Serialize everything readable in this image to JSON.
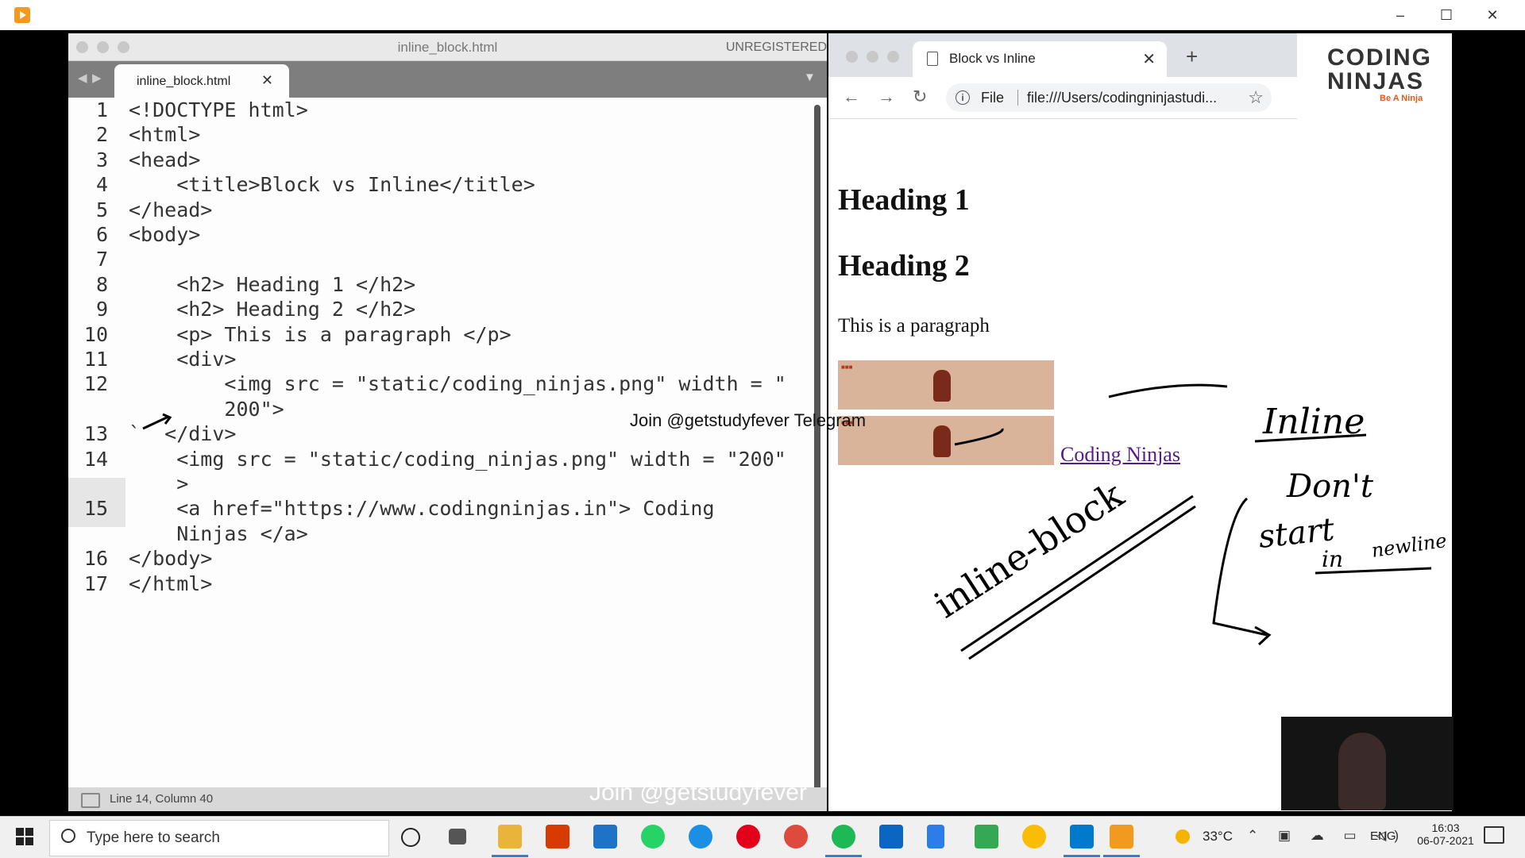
{
  "editor": {
    "title": "inline_block.html",
    "unregistered": "UNREGISTERED",
    "tab_label": "inline_block.html",
    "status": "Line 14, Column 40",
    "lines": [
      {
        "n": "1",
        "text": "<!DOCTYPE html>"
      },
      {
        "n": "2",
        "text": "<html>"
      },
      {
        "n": "3",
        "text": "<head>"
      },
      {
        "n": "4",
        "text": "    <title>Block vs Inline</title>"
      },
      {
        "n": "5",
        "text": "</head>"
      },
      {
        "n": "6",
        "text": "<body>"
      },
      {
        "n": "7",
        "text": ""
      },
      {
        "n": "8",
        "text": "    <h2> Heading 1 </h2>"
      },
      {
        "n": "9",
        "text": "    <h2> Heading 2 </h2>"
      },
      {
        "n": "10",
        "text": "    <p> This is a paragraph </p>"
      },
      {
        "n": "11",
        "text": "    <div>"
      },
      {
        "n": "12",
        "text": "        <img src = \"static/coding_ninjas.png\" width = \""
      },
      {
        "n": "",
        "text": "        200\">"
      },
      {
        "n": "13",
        "text": "`  </div>"
      },
      {
        "n": "14",
        "text": "    <img src = \"static/coding_ninjas.png\" width = \"200\""
      },
      {
        "n": "",
        "text": "    >"
      },
      {
        "n": "15",
        "text": "    <a href=\"https://www.codingninjas.in\"> Coding"
      },
      {
        "n": "",
        "text": "    Ninjas </a>"
      },
      {
        "n": "16",
        "text": "</body>"
      },
      {
        "n": "17",
        "text": "</html>"
      }
    ]
  },
  "browser": {
    "tab_title": "Block vs Inline",
    "new_tab": "+",
    "file_label": "File",
    "url": "file:///Users/codingninjastudi...",
    "logo_line1": "CODING",
    "logo_line2": "NINJAS",
    "logo_tag": "Be A Ninja",
    "heading1": "Heading 1",
    "heading2": "Heading 2",
    "paragraph": "This is a paragraph",
    "link": "Coding Ninjas"
  },
  "watermark": {
    "telegram": "Join @getstudyfever Telegram",
    "bottom": "Join @getstudyfever"
  },
  "annotations": {
    "inline_block": "inline-block",
    "inline": "Inline",
    "dont": "Don't",
    "start": "start",
    "in": "in",
    "newline": "newline"
  },
  "taskbar": {
    "search_placeholder": "Type here to search",
    "temperature": "33°C",
    "language": "ENG",
    "time": "16:03",
    "date": "06-07-2021"
  },
  "colors": {
    "editor_tag": "#1d6fb5",
    "link_visited": "#551a8b",
    "image_bg": "#d9b39a"
  }
}
